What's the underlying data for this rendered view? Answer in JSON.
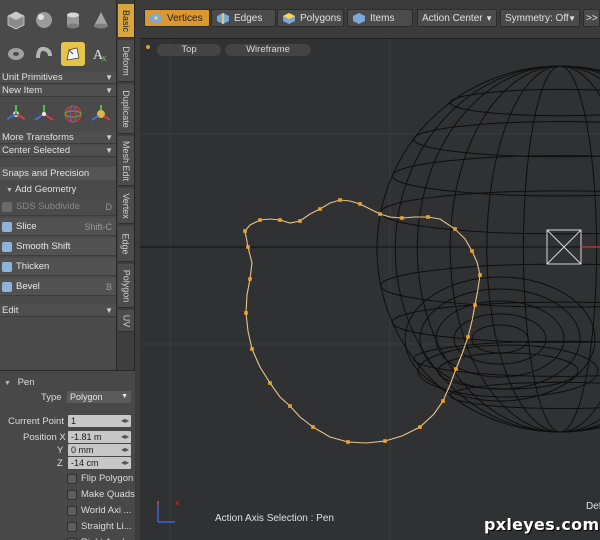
{
  "toolbar": {
    "vertices_label": "Vertices",
    "edges_label": "Edges",
    "polygons_label": "Polygons",
    "items_label": "Items",
    "action_center_label": "Action Center",
    "symmetry_label": "Symmetry: Off",
    "more_label": ">>"
  },
  "left_panel": {
    "icon_row_1": [
      "sphere-icon",
      "ball-icon",
      "cylinder-icon",
      "cone-icon"
    ],
    "icon_row_2": [
      "torus-icon",
      "tube-icon",
      "pen-icon",
      "text-icon"
    ],
    "primitives_dropdown": "Unit Primitives",
    "new_item_dropdown": "New Item",
    "icon_row_3": [
      "transform-icon",
      "axis-icon",
      "sphere-transform-icon",
      "flex-icon"
    ],
    "more_transforms_dropdown": "More Transforms",
    "center_selected_dropdown": "Center Selected",
    "snaps_label": "Snaps and Precision",
    "add_geometry_label": "Add Geometry",
    "tools": [
      {
        "label": "SDS Subdivide",
        "shortcut": "D",
        "disabled": true
      },
      {
        "label": "Slice",
        "shortcut": "Shift-C",
        "disabled": false
      },
      {
        "label": "Smooth Shift",
        "shortcut": "",
        "disabled": false
      },
      {
        "label": "Thicken",
        "shortcut": "",
        "disabled": false
      },
      {
        "label": "Bevel",
        "shortcut": "B",
        "disabled": false
      }
    ],
    "edit_dropdown": "Edit"
  },
  "vertical_tabs": [
    "Basic",
    "Deform",
    "Duplicate",
    "Mesh Edit",
    "Vertex",
    "Edge",
    "Polygon",
    "UV"
  ],
  "properties": {
    "title": "Pen",
    "type_label": "Type",
    "type_value": "Polygon",
    "current_point_label": "Current Point",
    "current_point_value": "1",
    "position_x_label": "Position X",
    "position_x_value": "-1.81 m",
    "y_label": "Y",
    "y_value": "0 mm",
    "z_label": "Z",
    "z_value": "-14 cm",
    "checks": [
      "Flip Polygon",
      "Make Quads",
      "World Axi ...",
      "Straight Li...",
      "Right Angl..."
    ]
  },
  "viewport": {
    "view_label": "Top",
    "shading_label": "Wireframe",
    "status_text": "Action Axis Selection : Pen",
    "def_text": "Def",
    "watermark": "pxleyes.com",
    "colors": {
      "background": "#2f3133",
      "pen_curve": "#e8c38a",
      "pen_points": "#f0a32a",
      "wire": "#0e0e0e",
      "axis_x": "#d03a3a",
      "axis_z": "#3a64d0"
    }
  }
}
